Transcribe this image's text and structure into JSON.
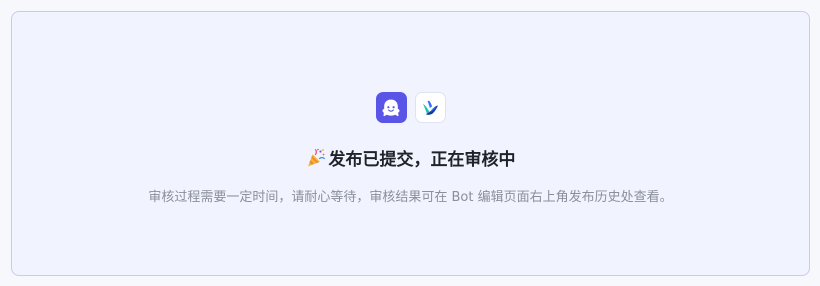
{
  "status": {
    "title": "发布已提交，正在审核中",
    "description": "审核过程需要一定时间，请耐心等待，审核结果可在 Bot 编辑页面右上角发布历史处查看。",
    "icons": [
      "bot-platform-icon",
      "feishu-icon"
    ],
    "title_emoji": "party-popper-icon"
  },
  "colors": {
    "panel_border": "#c6cbf2",
    "panel_background": "#f1f4fe",
    "bot_icon_background": "#5a55e6"
  }
}
